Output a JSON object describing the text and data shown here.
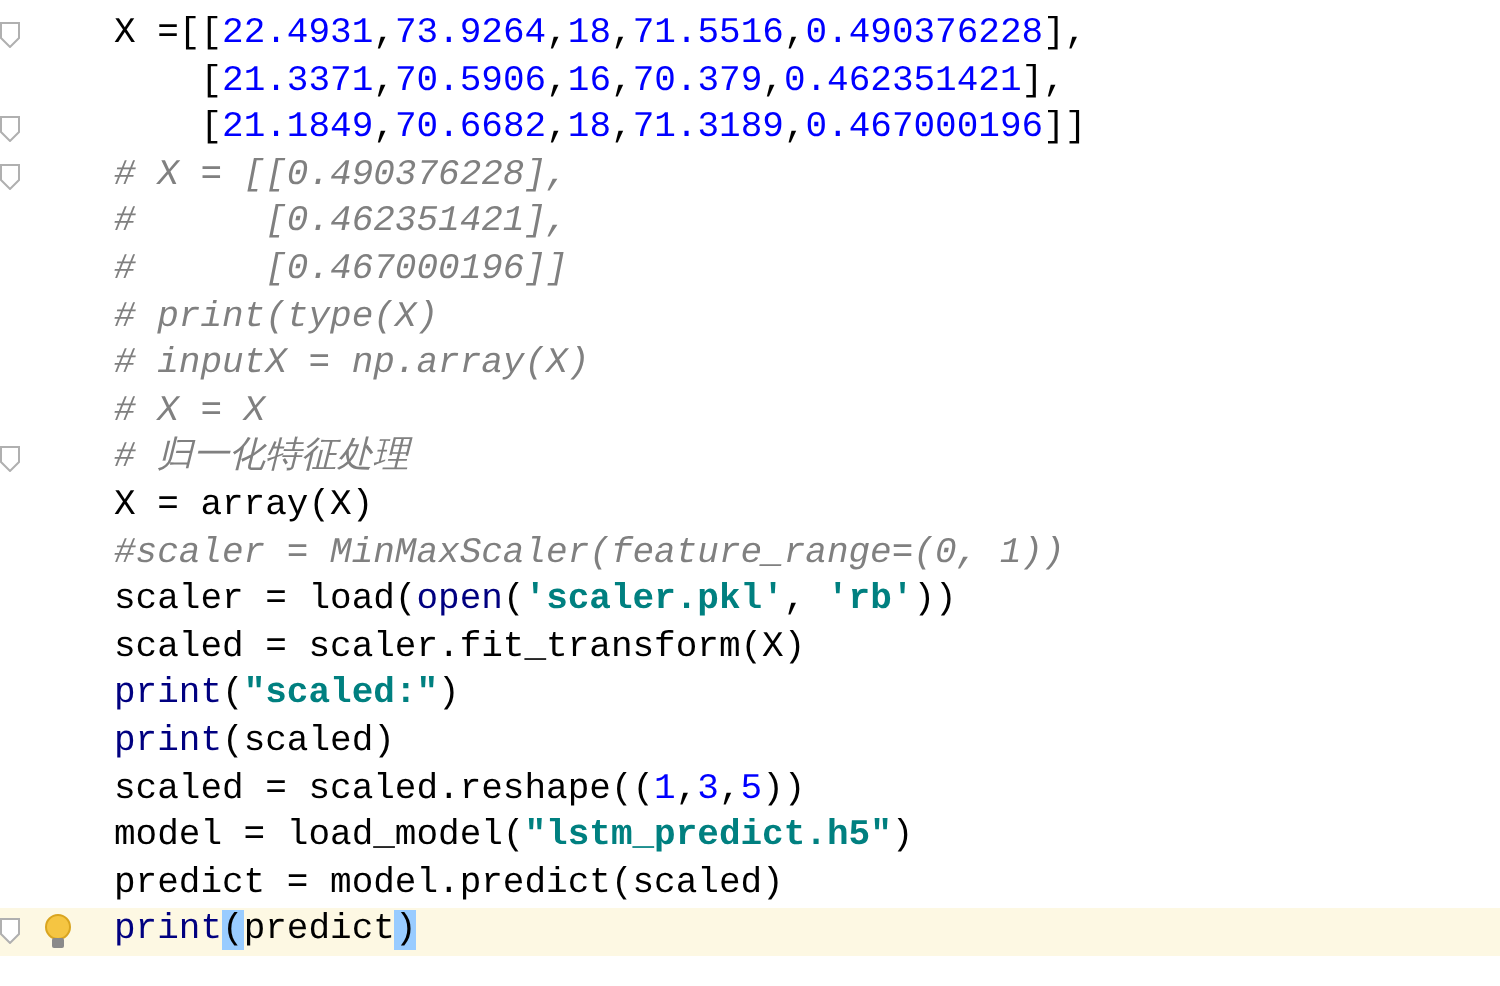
{
  "editor": {
    "lines": [
      {
        "fold_marker": true,
        "current": false,
        "lightbulb": false,
        "tokens": [
          {
            "kind": "plain",
            "text": "X =[["
          },
          {
            "kind": "number",
            "text": "22.4931"
          },
          {
            "kind": "plain",
            "text": ","
          },
          {
            "kind": "number",
            "text": "73.9264"
          },
          {
            "kind": "plain",
            "text": ","
          },
          {
            "kind": "number",
            "text": "18"
          },
          {
            "kind": "plain",
            "text": ","
          },
          {
            "kind": "number",
            "text": "71.5516"
          },
          {
            "kind": "plain",
            "text": ","
          },
          {
            "kind": "number",
            "text": "0.490376228"
          },
          {
            "kind": "plain",
            "text": "],"
          }
        ]
      },
      {
        "fold_marker": false,
        "current": false,
        "lightbulb": false,
        "tokens": [
          {
            "kind": "plain",
            "text": "    ["
          },
          {
            "kind": "number",
            "text": "21.3371"
          },
          {
            "kind": "plain",
            "text": ","
          },
          {
            "kind": "number",
            "text": "70.5906"
          },
          {
            "kind": "plain",
            "text": ","
          },
          {
            "kind": "number",
            "text": "16"
          },
          {
            "kind": "plain",
            "text": ","
          },
          {
            "kind": "number",
            "text": "70.379"
          },
          {
            "kind": "plain",
            "text": ","
          },
          {
            "kind": "number",
            "text": "0.462351421"
          },
          {
            "kind": "plain",
            "text": "],"
          }
        ]
      },
      {
        "fold_marker": true,
        "current": false,
        "lightbulb": false,
        "tokens": [
          {
            "kind": "plain",
            "text": "    ["
          },
          {
            "kind": "number",
            "text": "21.1849"
          },
          {
            "kind": "plain",
            "text": ","
          },
          {
            "kind": "number",
            "text": "70.6682"
          },
          {
            "kind": "plain",
            "text": ","
          },
          {
            "kind": "number",
            "text": "18"
          },
          {
            "kind": "plain",
            "text": ","
          },
          {
            "kind": "number",
            "text": "71.3189"
          },
          {
            "kind": "plain",
            "text": ","
          },
          {
            "kind": "number",
            "text": "0.467000196"
          },
          {
            "kind": "plain",
            "text": "]]"
          }
        ]
      },
      {
        "fold_marker": true,
        "current": false,
        "lightbulb": false,
        "tokens": [
          {
            "kind": "comment",
            "text": "# X = [[0.490376228],"
          }
        ]
      },
      {
        "fold_marker": false,
        "current": false,
        "lightbulb": false,
        "tokens": [
          {
            "kind": "comment",
            "text": "#      [0.462351421],"
          }
        ]
      },
      {
        "fold_marker": false,
        "current": false,
        "lightbulb": false,
        "tokens": [
          {
            "kind": "comment",
            "text": "#      [0.467000196]]"
          }
        ]
      },
      {
        "fold_marker": false,
        "current": false,
        "lightbulb": false,
        "tokens": [
          {
            "kind": "comment",
            "text": "# print(type(X)"
          }
        ]
      },
      {
        "fold_marker": false,
        "current": false,
        "lightbulb": false,
        "tokens": [
          {
            "kind": "comment",
            "text": "# inputX = np.array(X)"
          }
        ]
      },
      {
        "fold_marker": false,
        "current": false,
        "lightbulb": false,
        "tokens": [
          {
            "kind": "comment",
            "text": "# X = X"
          }
        ]
      },
      {
        "fold_marker": true,
        "current": false,
        "lightbulb": false,
        "tokens": [
          {
            "kind": "comment",
            "text": "# 归一化特征处理"
          }
        ]
      },
      {
        "fold_marker": false,
        "current": false,
        "lightbulb": false,
        "tokens": [
          {
            "kind": "plain",
            "text": "X = array(X)"
          }
        ]
      },
      {
        "fold_marker": false,
        "current": false,
        "lightbulb": false,
        "tokens": [
          {
            "kind": "comment",
            "text": "#scaler = MinMaxScaler(feature_range=(0, 1))"
          }
        ]
      },
      {
        "fold_marker": false,
        "current": false,
        "lightbulb": false,
        "tokens": [
          {
            "kind": "plain",
            "text": "scaler = load("
          },
          {
            "kind": "builtin",
            "text": "open"
          },
          {
            "kind": "plain",
            "text": "("
          },
          {
            "kind": "string",
            "text": "'scaler.pkl'"
          },
          {
            "kind": "plain",
            "text": ", "
          },
          {
            "kind": "string",
            "text": "'rb'"
          },
          {
            "kind": "plain",
            "text": "))"
          }
        ]
      },
      {
        "fold_marker": false,
        "current": false,
        "lightbulb": false,
        "tokens": [
          {
            "kind": "plain",
            "text": "scaled = scaler.fit_transform(X)"
          }
        ]
      },
      {
        "fold_marker": false,
        "current": false,
        "lightbulb": false,
        "tokens": [
          {
            "kind": "builtin",
            "text": "print"
          },
          {
            "kind": "plain",
            "text": "("
          },
          {
            "kind": "string",
            "text": "\"scaled:\""
          },
          {
            "kind": "plain",
            "text": ")"
          }
        ]
      },
      {
        "fold_marker": false,
        "current": false,
        "lightbulb": false,
        "tokens": [
          {
            "kind": "builtin",
            "text": "print"
          },
          {
            "kind": "plain",
            "text": "(scaled)"
          }
        ]
      },
      {
        "fold_marker": false,
        "current": false,
        "lightbulb": false,
        "tokens": [
          {
            "kind": "plain",
            "text": "scaled = scaled.reshape(("
          },
          {
            "kind": "number",
            "text": "1"
          },
          {
            "kind": "plain",
            "text": ","
          },
          {
            "kind": "number",
            "text": "3"
          },
          {
            "kind": "plain",
            "text": ","
          },
          {
            "kind": "number",
            "text": "5"
          },
          {
            "kind": "plain",
            "text": "))"
          }
        ]
      },
      {
        "fold_marker": false,
        "current": false,
        "lightbulb": false,
        "tokens": [
          {
            "kind": "plain",
            "text": "model = load_model("
          },
          {
            "kind": "string",
            "text": "\"lstm_predict.h5\""
          },
          {
            "kind": "plain",
            "text": ")"
          }
        ]
      },
      {
        "fold_marker": false,
        "current": false,
        "lightbulb": false,
        "tokens": [
          {
            "kind": "plain",
            "text": "predict = model.predict(scaled)"
          }
        ]
      },
      {
        "fold_marker": true,
        "current": true,
        "lightbulb": true,
        "tokens": [
          {
            "kind": "builtin",
            "text": "print"
          },
          {
            "kind": "match",
            "text": "("
          },
          {
            "kind": "plain",
            "text": "predict"
          },
          {
            "kind": "match",
            "text": ")"
          }
        ]
      }
    ]
  }
}
